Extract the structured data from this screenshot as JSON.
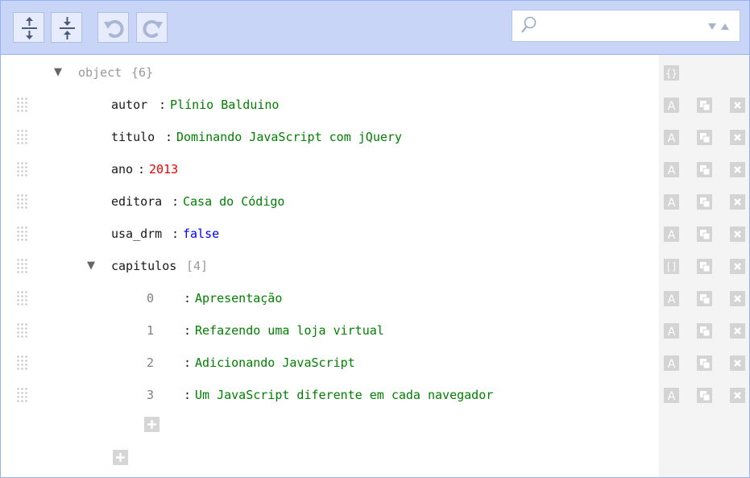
{
  "toolbar": {
    "buttons": [
      {
        "name": "expand-all",
        "icon": "expand-all-icon"
      },
      {
        "name": "collapse-all",
        "icon": "collapse-all-icon"
      },
      {
        "name": "undo",
        "icon": "undo-icon"
      },
      {
        "name": "redo",
        "icon": "redo-icon"
      }
    ],
    "search": {
      "value": "",
      "placeholder": "",
      "icon": "search-icon",
      "next_icon": "triangle-down-icon",
      "prev_icon": "triangle-up-icon"
    }
  },
  "colors": {
    "toolbar_bg": "#c9d5f7",
    "border": "#97b0f8",
    "string": "#008000",
    "number": "#ee0000",
    "boolean": "#0000ff",
    "meta": "#999999",
    "gutter_bg": "#f4f4f4"
  },
  "tree": {
    "root": {
      "label": "object",
      "meta": "{6}",
      "type_icon": "object-type-icon"
    },
    "fields": [
      {
        "key": "autor",
        "sep": ":",
        "value": "Plínio Balduino",
        "type": "string"
      },
      {
        "key": "titulo",
        "sep": ":",
        "value": "Dominando JavaScript com jQuery",
        "type": "string"
      },
      {
        "key": "ano",
        "sep": ":",
        "value": "2013",
        "type": "number"
      },
      {
        "key": "editora",
        "sep": ":",
        "value": "Casa do Código",
        "type": "string"
      },
      {
        "key": "usa_drm",
        "sep": ":",
        "value": "false",
        "type": "boolean"
      }
    ],
    "array": {
      "key": "capitulos",
      "meta": "[4]",
      "type_icon": "array-type-icon",
      "items": [
        {
          "index": "0",
          "sep": ":",
          "value": "Apresentação"
        },
        {
          "index": "1",
          "sep": ":",
          "value": "Refazendo uma loja virtual"
        },
        {
          "index": "2",
          "sep": ":",
          "value": "Adicionando JavaScript"
        },
        {
          "index": "3",
          "sep": ":",
          "value": "Um JavaScript diferente em cada navegador"
        }
      ]
    }
  }
}
